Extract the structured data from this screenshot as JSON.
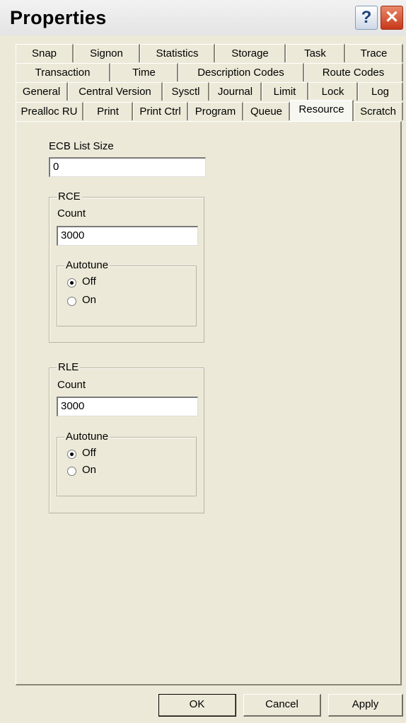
{
  "window": {
    "title": "Properties"
  },
  "title_buttons": {
    "help": "?",
    "close": "✕"
  },
  "tabs": {
    "row1": [
      "Snap",
      "Signon",
      "Statistics",
      "Storage",
      "Task",
      "Trace"
    ],
    "row2": [
      "Transaction",
      "Time",
      "Description Codes",
      "Route Codes"
    ],
    "row3": [
      "General",
      "Central Version",
      "Sysctl",
      "Journal",
      "Limit",
      "Lock",
      "Log"
    ],
    "row4": [
      "Prealloc RU",
      "Print",
      "Print Ctrl",
      "Program",
      "Queue",
      "Resource",
      "Scratch"
    ],
    "active": "Resource"
  },
  "resource": {
    "ecb_label": "ECB List Size",
    "ecb_value": "0",
    "rce": {
      "group_label": "RCE",
      "count_label": "Count",
      "count_value": "3000",
      "autotune_label": "Autotune",
      "off_label": "Off",
      "on_label": "On",
      "selected": "Off"
    },
    "rle": {
      "group_label": "RLE",
      "count_label": "Count",
      "count_value": "3000",
      "autotune_label": "Autotune",
      "off_label": "Off",
      "on_label": "On",
      "selected": "Off"
    }
  },
  "buttons": {
    "ok": "OK",
    "cancel": "Cancel",
    "apply": "Apply"
  }
}
